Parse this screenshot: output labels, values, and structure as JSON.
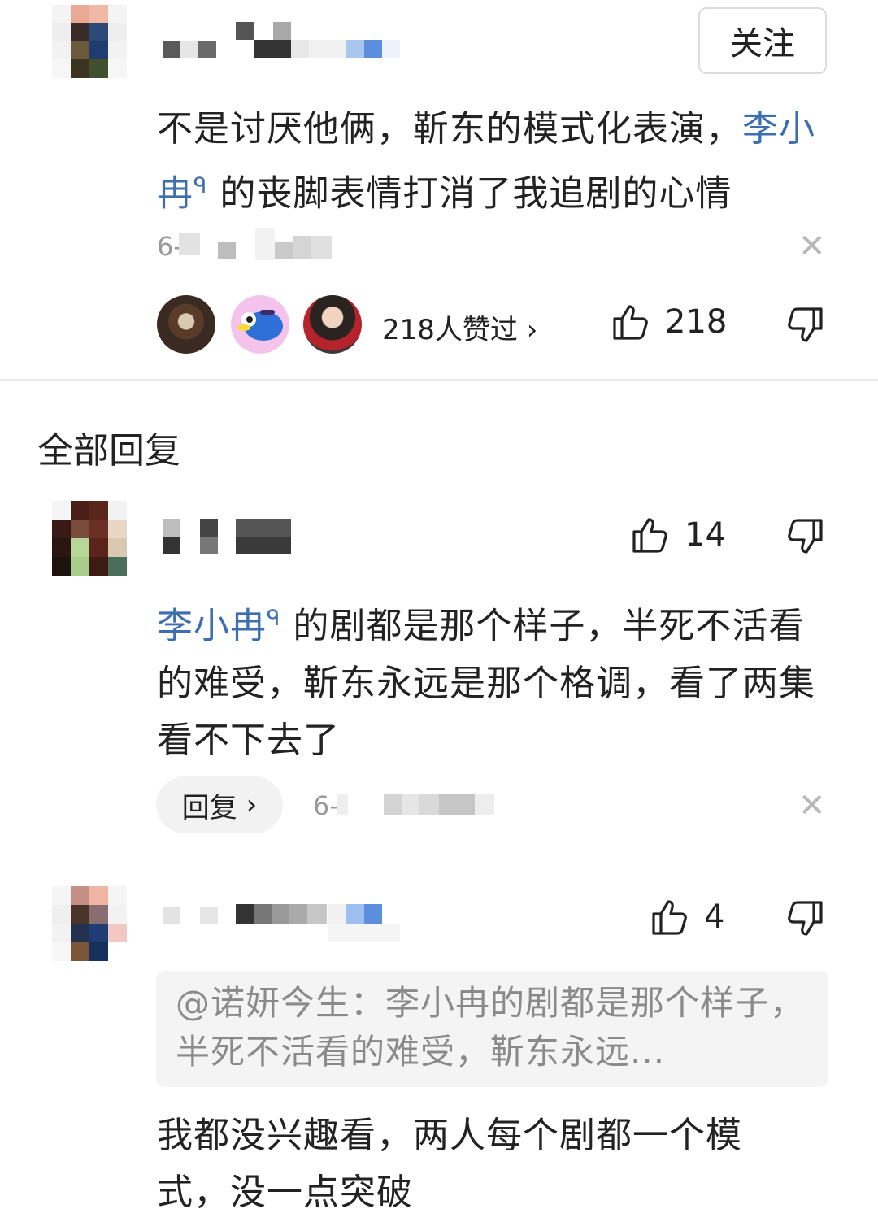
{
  "top_comment": {
    "follow_label": "关注",
    "text_before": "不是讨厌他俩，靳东的模式化表演，",
    "mention": "李小冉",
    "text_after": "的丧脚表情打消了我追剧的心情",
    "date_prefix": "6-",
    "likers_label": "218人赞过",
    "likers_chevron": "›",
    "like_count": "218"
  },
  "section_title": "全部回复",
  "replies": [
    {
      "like_count": "14",
      "mention": "李小冉",
      "text_after": "的剧都是那个样子，半死不活看的难受，靳东永远是那个格调，看了两集看不下去了",
      "reply_label": "回复",
      "reply_chevron": "›",
      "date_prefix": "6-"
    },
    {
      "like_count": "4",
      "quote": "@诺妍今生：李小冉的剧都是那个样子，半死不活看的难受，靳东永远...",
      "text": "我都没兴趣看，两人每个剧都一个模式，没一点突破"
    }
  ],
  "icons": {
    "like": "thumbs-up-icon",
    "dislike": "thumbs-down-icon",
    "close": "close-icon",
    "search": "search-icon"
  },
  "colors": {
    "mention": "#3d6fb0",
    "meta": "#9a9a9a",
    "quote_bg": "#f4f4f4"
  }
}
